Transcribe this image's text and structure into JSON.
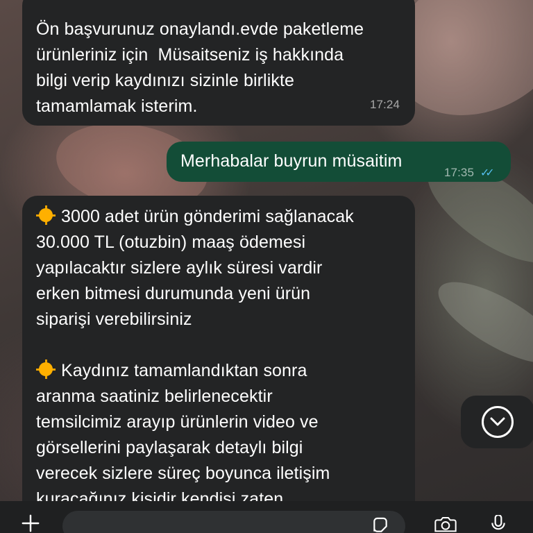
{
  "messages": [
    {
      "direction": "incoming",
      "text": "Ön başvurunuz onaylandı.evde paketleme\nürünleriniz için  Müsaitseniz iş hakkında\nbilgi verip kaydınızı sizinle birlikte\ntamamlamak isterim.",
      "time": "17:24"
    },
    {
      "direction": "outgoing",
      "text": "Merhabalar buyrun müsaitim",
      "time": "17:35",
      "status": "read"
    },
    {
      "direction": "incoming",
      "paragraph1": "3000 adet ürün gönderimi sağlanacak\n30.000 TL (otuzbin) maaş ödemesi\nyapılacaktır sizlere aylık süresi vardir\nerken bitmesi durumunda yeni ürün\nsiparişi verebilirsiniz",
      "paragraph2": "Kaydınız tamamlandıktan sonra\naranma saatiniz belirlenecektir\ntemsilcimiz arayıp ürünlerin video ve\ngörsellerini paylaşarak detaylı bilgi\nverecek sizlere süreç boyunca iletişim\nkuracağınız kişidir kendisi zaten"
    }
  ],
  "icons": {
    "emoji": "sun-emoji",
    "scroll": "chevron-down-icon",
    "bar": [
      "plus-icon",
      "sticker-icon",
      "camera-icon",
      "microphone-icon"
    ]
  },
  "colors": {
    "incoming_bubble": "#232425",
    "outgoing_bubble": "#134d37",
    "read_ticks": "#53bdeb"
  },
  "composer": {
    "value": ""
  }
}
